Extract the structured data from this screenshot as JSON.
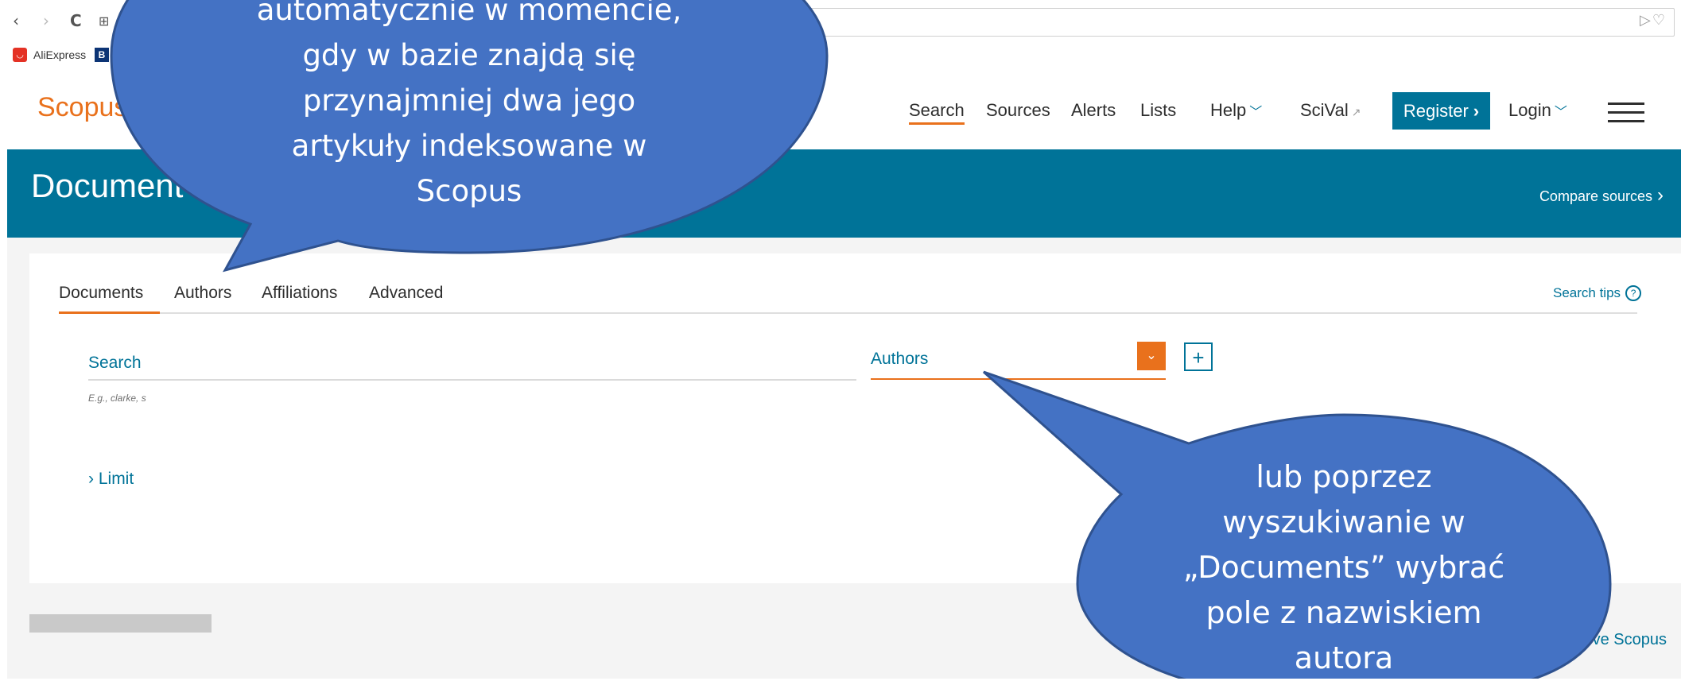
{
  "browser": {
    "back_glyph": "‹",
    "forward_glyph": "›",
    "reload_glyph": "C",
    "apps_glyph": "⊞",
    "address_icons": "▷♡",
    "bookmarks": [
      {
        "label": "AliExpress",
        "icon": "aliexpress-icon"
      },
      {
        "label": "B",
        "icon": "booking-icon"
      }
    ]
  },
  "header": {
    "logo": "Scopus",
    "nav": {
      "search": "Search",
      "sources": "Sources",
      "alerts": "Alerts",
      "lists": "Lists",
      "help": "Help",
      "scival": "SciVal",
      "register": "Register",
      "login": "Login"
    }
  },
  "banner": {
    "title": "Document s",
    "compare": "Compare sources"
  },
  "search_form": {
    "tabs": [
      "Documents",
      "Authors",
      "Affiliations",
      "Advanced"
    ],
    "active_tab": "Documents",
    "search_tips": "Search tips",
    "search_label": "Search",
    "search_example": "E.g., clarke, s",
    "field_select": "Authors",
    "limit_label": "Limit"
  },
  "footer": {
    "improve_link": "rove Scopus"
  },
  "callouts": {
    "top": [
      "automatycznie w momencie,",
      "gdy w bazie znajdą się",
      "przynajmniej dwa jego",
      "artykuły indeksowane w",
      "Scopus"
    ],
    "bottom": [
      "lub poprzez",
      "wyszukiwanie w",
      "„Documents” wybrać",
      "pole z nazwiskiem",
      "autora"
    ]
  },
  "colors": {
    "scopus_orange": "#e9711c",
    "scopus_teal": "#007398",
    "callout_fill": "#4472c4",
    "callout_stroke": "#2f528f"
  }
}
